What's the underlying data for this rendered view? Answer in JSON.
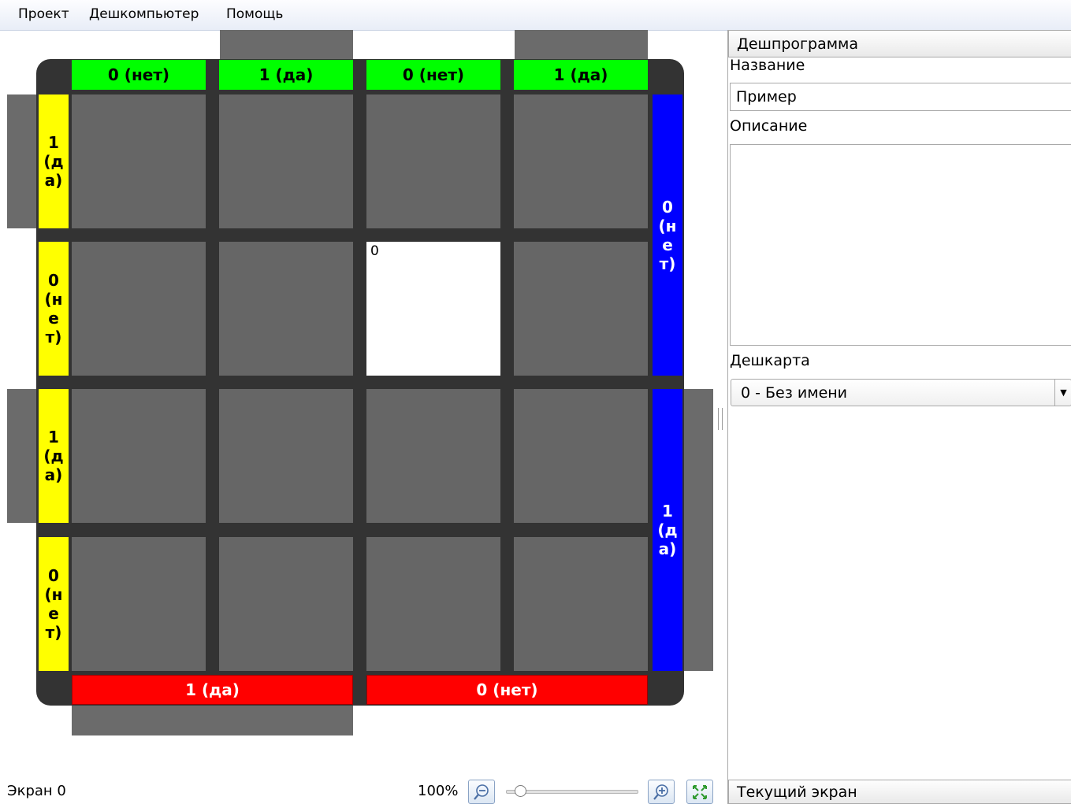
{
  "menu": {
    "items": [
      "Проект",
      "Дешкомпьютер",
      "Помощь"
    ]
  },
  "board": {
    "top_labels": [
      "0 (нет)",
      "1 (да)",
      "0 (нет)",
      "1 (да)"
    ],
    "bottom_labels": [
      "1 (да)",
      "0 (нет)"
    ],
    "left_labels": [
      "1 (да)",
      "0 (нет)",
      "1 (да)",
      "0 (нет)"
    ],
    "right_labels": [
      "0 (нет)",
      "1 (да)"
    ],
    "active_cell_value": "0",
    "colors": {
      "top": "#00ff00",
      "bottom": "#ff0000",
      "left": "#ffff00",
      "right": "#0000ff",
      "cell": "#666666",
      "active": "#ffffff"
    }
  },
  "status": {
    "screen": "Экран 0",
    "zoom": "100%"
  },
  "panel": {
    "header": "Дешпрограмма",
    "name_label": "Название",
    "name_value": "Пример",
    "description_label": "Описание",
    "description_value": "",
    "map_label": "Дешкарта",
    "map_selected": "0 - Без имени",
    "footer": "Текущий экран"
  }
}
